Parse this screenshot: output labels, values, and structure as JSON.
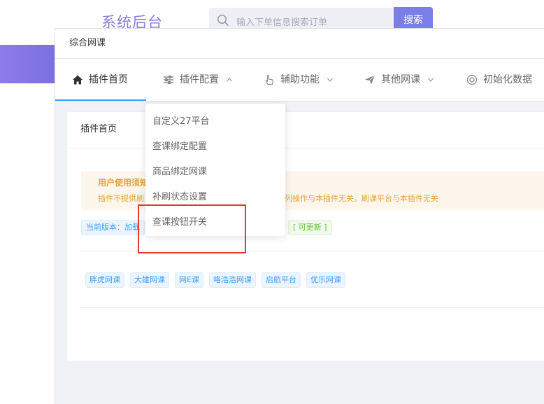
{
  "background": {
    "app_title": "系统后台",
    "search": {
      "placeholder": "输入下单信息搜索订单",
      "button_label": "搜索"
    }
  },
  "dialog": {
    "title": "综合网课",
    "menu": [
      {
        "label": "插件首页",
        "icon": "home-icon",
        "active": true
      },
      {
        "label": "插件配置",
        "icon": "sliders-icon",
        "expanded": true
      },
      {
        "label": "辅助功能",
        "icon": "pointer-hand-icon"
      },
      {
        "label": "其他网课",
        "icon": "paper-plane-icon"
      },
      {
        "label": "初始化数据",
        "icon": "lifebuoy-icon"
      }
    ],
    "dropdown": [
      "自定义27平台",
      "查课绑定配置",
      "商品绑定网课",
      "补刷状态设置",
      "查课按钮开关"
    ],
    "card": {
      "title": "插件首页",
      "notice_title": "用户使用须知",
      "notice_text": "插件不提供刷",
      "notice_text_right": "系列操作与本插件无关。刷课平台与本插件无关",
      "version_label": "当前版本：加载",
      "update_tag": "[ 可更新 ]",
      "platforms": [
        "胖虎网课",
        "大雄网课",
        "网E课",
        "咯浩浩网课",
        "启航平台",
        "优乐网课"
      ]
    }
  },
  "colors": {
    "accent": "#409eff",
    "warning": "#e6a23c",
    "highlight": "#e53935",
    "brand_purple": "#8a7bd8"
  }
}
